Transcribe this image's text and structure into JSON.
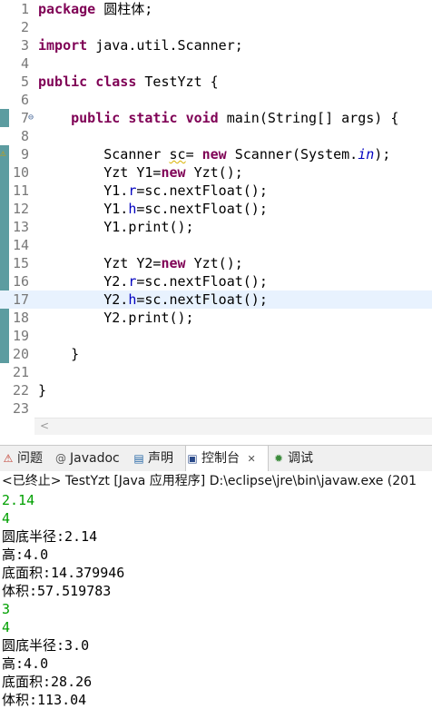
{
  "editor": {
    "lines": [
      {
        "num": "1",
        "html": "<span class=\"kw\">package</span> 圆柱体;"
      },
      {
        "num": "2",
        "html": ""
      },
      {
        "num": "3",
        "html": "<span class=\"kw\">import</span> java.util.Scanner;"
      },
      {
        "num": "4",
        "html": ""
      },
      {
        "num": "5",
        "html": "<span class=\"kw\">public</span> <span class=\"kw\">class</span> TestYzt {"
      },
      {
        "num": "6",
        "html": ""
      },
      {
        "num": "7",
        "html": "    <span class=\"kw\">public</span> <span class=\"kw\">static</span> <span class=\"kw\">void</span> main(String[] args) {"
      },
      {
        "num": "8",
        "html": ""
      },
      {
        "num": "9",
        "html": "        Scanner <span class=\"warn\">sc</span>= <span class=\"kw\">new</span> Scanner(System.<span class=\"stat\">in</span>);"
      },
      {
        "num": "10",
        "html": "        Yzt Y1=<span class=\"kw\">new</span> Yzt();"
      },
      {
        "num": "11",
        "html": "        Y1.<span class=\"fld\">r</span>=sc.nextFloat();"
      },
      {
        "num": "12",
        "html": "        Y1.<span class=\"fld\">h</span>=sc.nextFloat();"
      },
      {
        "num": "13",
        "html": "        Y1.print();"
      },
      {
        "num": "14",
        "html": ""
      },
      {
        "num": "15",
        "html": "        Yzt Y2=<span class=\"kw\">new</span> Yzt();"
      },
      {
        "num": "16",
        "html": "        Y2.<span class=\"fld\">r</span>=sc.nextFloat();"
      },
      {
        "num": "17",
        "html": "        Y2.<span class=\"fld\">h</span>=sc.nextFloat();"
      },
      {
        "num": "18",
        "html": "        Y2.print();"
      },
      {
        "num": "19",
        "html": ""
      },
      {
        "num": "20",
        "html": "    }"
      },
      {
        "num": "21",
        "html": ""
      },
      {
        "num": "22",
        "html": "}"
      },
      {
        "num": "23",
        "html": ""
      }
    ],
    "current_line": 17
  },
  "tabs": [
    {
      "label": "问题",
      "icon": "problems-icon"
    },
    {
      "label": "Javadoc",
      "icon": "javadoc-icon"
    },
    {
      "label": "声明",
      "icon": "declaration-icon"
    },
    {
      "label": "控制台",
      "icon": "console-icon",
      "close": "✕"
    },
    {
      "label": "调试",
      "icon": "debug-icon"
    }
  ],
  "console": {
    "title": "<已终止> TestYzt [Java 应用程序] D:\\eclipse\\jre\\bin\\javaw.exe  (201",
    "output": [
      {
        "text": "2.14",
        "input": true
      },
      {
        "text": "4",
        "input": true
      },
      {
        "text": "圆底半径:2.14",
        "input": false
      },
      {
        "text": "高:4.0",
        "input": false
      },
      {
        "text": "底面积:14.379946",
        "input": false
      },
      {
        "text": "体积:57.519783",
        "input": false
      },
      {
        "text": "3",
        "input": true
      },
      {
        "text": "4",
        "input": true
      },
      {
        "text": "圆底半径:3.0",
        "input": false
      },
      {
        "text": "高:4.0",
        "input": false
      },
      {
        "text": "底面积:28.26",
        "input": false
      },
      {
        "text": "体积:113.04",
        "input": false
      }
    ]
  },
  "colors": {
    "keyword": "#7f0055",
    "field": "#0000c0",
    "console_input": "#00a000",
    "change_bar": "#5c9ca0"
  }
}
